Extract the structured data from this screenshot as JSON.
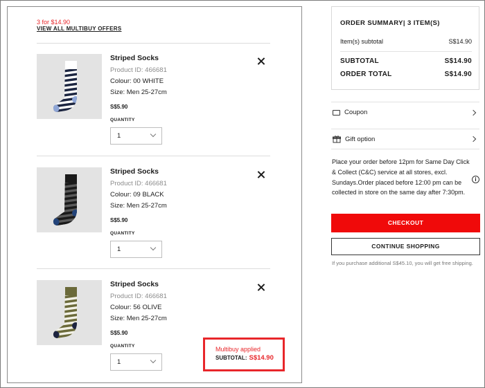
{
  "cart": {
    "promo_price": "3 for $14.90",
    "promo_link": "VIEW ALL MULTIBUY OFFERS",
    "items": [
      {
        "name": "Striped Socks",
        "product_id": "Product ID: 466681",
        "colour": "Colour: 00 WHITE",
        "size": "Size: Men 25-27cm",
        "price": "S$5.90",
        "quantity_label": "QUANTITY",
        "quantity": "1",
        "stripe_a": "#1c2540",
        "stripe_b": "#ffffff",
        "accent": "#8fa6d6"
      },
      {
        "name": "Striped Socks",
        "product_id": "Product ID: 466681",
        "colour": "Colour: 09 BLACK",
        "size": "Size: Men 25-27cm",
        "price": "S$5.90",
        "quantity_label": "QUANTITY",
        "quantity": "1",
        "stripe_a": "#1a1a1a",
        "stripe_b": "#5a5a5a",
        "accent": "#23447a"
      },
      {
        "name": "Striped Socks",
        "product_id": "Product ID: 466681",
        "colour": "Colour: 56 OLIVE",
        "size": "Size: Men 25-27cm",
        "price": "S$5.90",
        "quantity_label": "QUANTITY",
        "quantity": "1",
        "stripe_a": "#6b6a3a",
        "stripe_b": "#f2f1e6",
        "accent": "#1d2440"
      }
    ],
    "multibuy": {
      "title": "Multibuy applied",
      "subtotal_label": "SUBTOTAL:",
      "subtotal_value": "S$14.90"
    }
  },
  "summary": {
    "title": "ORDER SUMMARY| 3 ITEM(S)",
    "items_subtotal_label": "Item(s) subtotal",
    "items_subtotal_value": "S$14.90",
    "subtotal_label": "SUBTOTAL",
    "subtotal_value": "S$14.90",
    "order_total_label": "ORDER TOTAL",
    "order_total_value": "S$14.90"
  },
  "options": {
    "coupon_label": "Coupon",
    "gift_label": "Gift option"
  },
  "notice": "Place your order before 12pm for Same Day Click & Collect (C&C) service at all stores, excl. Sundays.Order placed before 12:00 pm can be collected in store on the same day after 7:30pm.",
  "buttons": {
    "checkout": "CHECKOUT",
    "continue": "CONTINUE SHOPPING"
  },
  "free_shipping_note": "If you purchase additional S$45.10, you will get free shipping.",
  "colors": {
    "accent_red": "#f00a0a",
    "promo_red": "#e8262a"
  }
}
